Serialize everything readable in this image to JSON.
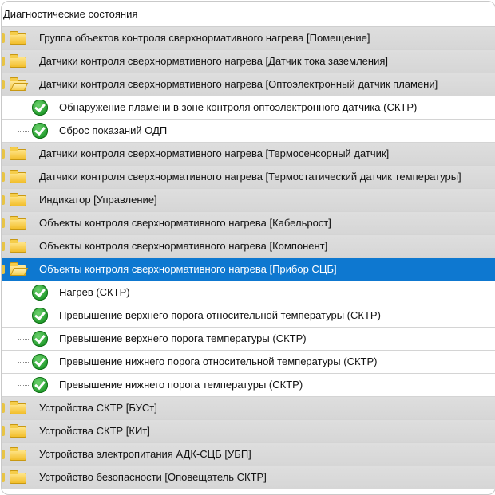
{
  "tree": {
    "root_label": "Диагностические состояния",
    "rows": [
      {
        "type": "group",
        "label": "Группа объектов контроля сверхнормативного нагрева [Помещение]",
        "open": false
      },
      {
        "type": "group",
        "label": "Датчики контроля сверхнормативного нагрева [Датчик тока заземления]",
        "open": false
      },
      {
        "type": "group",
        "label": "Датчики контроля сверхнормативного нагрева [Оптоэлектронный датчик пламени]",
        "open": true
      },
      {
        "type": "child",
        "label": "Обнаружение пламени в зоне контроля оптоэлектронного датчика (СКТР)"
      },
      {
        "type": "child",
        "label": "Сброс показаний ОДП"
      },
      {
        "type": "group",
        "label": "Датчики контроля сверхнормативного нагрева [Термосенсорный датчик]",
        "open": false
      },
      {
        "type": "group",
        "label": "Датчики контроля сверхнормативного нагрева [Термостатический датчик температуры]",
        "open": false
      },
      {
        "type": "group",
        "label": "Индикатор [Управление]",
        "open": false
      },
      {
        "type": "group",
        "label": "Объекты контроля сверхнормативного нагрева [Кабельрост]",
        "open": false
      },
      {
        "type": "group",
        "label": "Объекты контроля сверхнормативного нагрева [Компонент]",
        "open": false
      },
      {
        "type": "group",
        "label": "Объекты контроля сверхнормативного нагрева [Прибор СЦБ]",
        "open": true,
        "selected": true
      },
      {
        "type": "child",
        "label": "Нагрев (СКТР)"
      },
      {
        "type": "child",
        "label": "Превышение верхнего порога относительной температуры (СКТР)"
      },
      {
        "type": "child",
        "label": "Превышение верхнего порога температуры (СКТР)"
      },
      {
        "type": "child",
        "label": "Превышение нижнего порога относительной температуры (СКТР)"
      },
      {
        "type": "child",
        "label": "Превышение нижнего порога температуры (СКТР)"
      },
      {
        "type": "group",
        "label": "Устройства СКТР [БУСт]",
        "open": false
      },
      {
        "type": "group",
        "label": "Устройства СКТР [КИт]",
        "open": false
      },
      {
        "type": "group",
        "label": "Устройства электропитания АДК-СЦБ [УБП]",
        "open": false
      },
      {
        "type": "group",
        "label": "Устройство безопасности [Оповещатель СКТР]",
        "open": false
      }
    ]
  },
  "colors": {
    "selected_bg": "#0e78d0",
    "group_bg": "#d9d9d9",
    "check_green": "#1f9a2a",
    "folder_yellow": "#f2be2b"
  }
}
